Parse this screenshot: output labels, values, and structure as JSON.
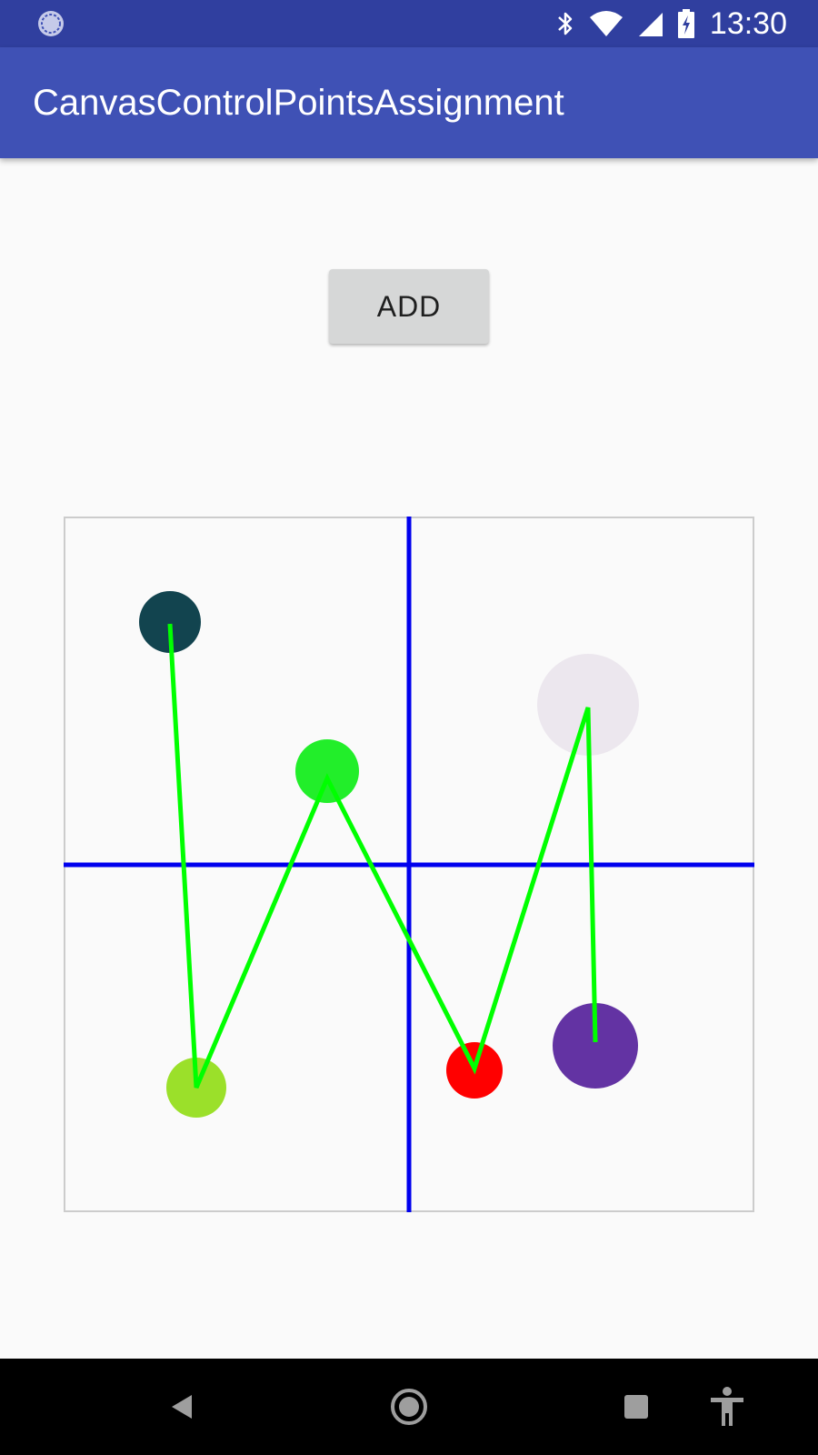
{
  "status_bar": {
    "time": "13:30",
    "icons": [
      "sync-icon",
      "bluetooth-icon",
      "wifi-icon",
      "signal-icon",
      "battery-charging-icon"
    ]
  },
  "app_bar": {
    "title": "CanvasControlPointsAssignment"
  },
  "toolbar": {
    "add_label": "ADD"
  },
  "canvas": {
    "colors": {
      "border": "#cccccc",
      "axis": "#0000ee",
      "path": "#00ff00"
    },
    "points": [
      {
        "color": "#12444f"
      },
      {
        "color": "#9be02a"
      },
      {
        "color": "#22ee2a"
      },
      {
        "color": "#ff0000"
      },
      {
        "color": "#ece7ee"
      },
      {
        "color": "#6333a3"
      }
    ]
  },
  "nav_bar": {
    "icons": [
      "back-icon",
      "home-icon",
      "recents-icon",
      "accessibility-icon"
    ]
  }
}
